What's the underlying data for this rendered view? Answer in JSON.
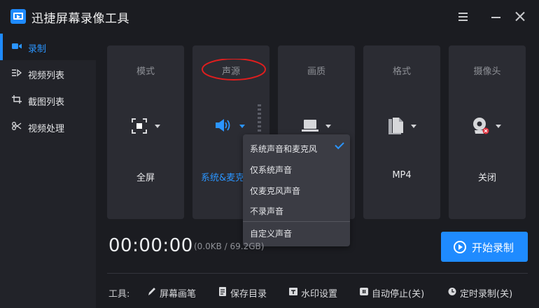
{
  "app": {
    "title": "迅捷屏幕录像工具",
    "icon": "video-camera-logo"
  },
  "window_controls": {
    "menu": "menu-icon",
    "minimize": "minimize-icon",
    "close": "close-icon"
  },
  "sidebar": {
    "items": [
      {
        "label": "录制",
        "icon": "record-icon",
        "active": true
      },
      {
        "label": "视频列表",
        "icon": "video-list-icon",
        "active": false
      },
      {
        "label": "截图列表",
        "icon": "screenshot-list-icon",
        "active": false
      },
      {
        "label": "视频处理",
        "icon": "video-process-icon",
        "active": false
      }
    ]
  },
  "cards": {
    "mode": {
      "title": "模式",
      "value": "全屏",
      "icon": "fullscreen-icon"
    },
    "audio": {
      "title": "声源",
      "value": "系统&麦克风",
      "icon": "speaker-icon"
    },
    "quality": {
      "title": "画质",
      "value": "",
      "icon": "laptop-icon"
    },
    "format": {
      "title": "格式",
      "value": "MP4",
      "icon": "file-icon"
    },
    "camera": {
      "title": "摄像头",
      "value": "关闭",
      "icon": "webcam-icon"
    }
  },
  "audio_menu": {
    "options": [
      "系统声音和麦克风",
      "仅系统声音",
      "仅麦克风声音",
      "不录声音"
    ],
    "selected": "系统声音和麦克风",
    "custom": "自定义声音"
  },
  "status": {
    "timer": "00:00:00",
    "sizes": "(0.0KB / 69.2GB)"
  },
  "start_button": {
    "label": "开始录制"
  },
  "tools": {
    "label": "工具:",
    "items": [
      {
        "label": "屏幕画笔",
        "icon": "pen-icon"
      },
      {
        "label": "保存目录",
        "icon": "folder-icon"
      },
      {
        "label": "水印设置",
        "icon": "watermark-icon"
      },
      {
        "label": "自动停止(关)",
        "icon": "auto-stop-icon"
      },
      {
        "label": "定时录制(关)",
        "icon": "clock-icon"
      }
    ]
  },
  "colors": {
    "accent": "#1f8bff",
    "background": "#1b1c21",
    "card": "#2b2c33",
    "annotation": "#e01e1e"
  }
}
